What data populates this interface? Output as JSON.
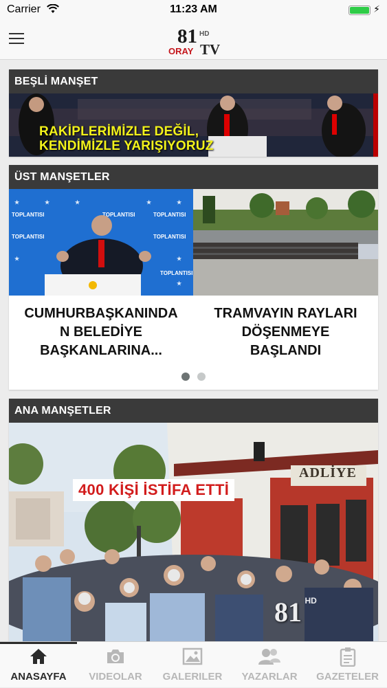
{
  "status_bar": {
    "carrier": "Carrier",
    "time": "11:23 AM"
  },
  "header": {
    "logo_text": "81",
    "logo_hd": "HD",
    "logo_brand": "ORAY",
    "logo_tv": "TV"
  },
  "sections": {
    "besli": {
      "title": "BEŞLİ MANŞET",
      "image_caption_line1": "RAKİPLERİMİZLE DEĞİL,",
      "image_caption_line2": "KENDİMİZLE YARIŞIYORUZ"
    },
    "ust": {
      "title": "ÜST MANŞETLER",
      "items": [
        {
          "headline_line1": "CUMHURBAŞKANINDA",
          "headline_line2": "N BELEDİYE",
          "headline_line3": "BAŞKANLARINA..."
        },
        {
          "headline_line1": "TRAMVAYIN RAYLARI",
          "headline_line2": "DÖŞENMEYE",
          "headline_line3": "BAŞLANDI"
        }
      ],
      "poster_word": "TOPLANTISI",
      "active_page": 1,
      "page_count": 2
    },
    "ana": {
      "title": "ANA MANŞETLER",
      "image_caption": "400 KİŞİ İSTİFA ETTİ",
      "building_sign": "ADLİYE",
      "watermark": "81",
      "watermark_hd": "HD"
    }
  },
  "tabbar": {
    "tabs": [
      {
        "label": "ANASAYFA",
        "icon": "home-icon",
        "active": true
      },
      {
        "label": "VIDEOLAR",
        "icon": "camera-icon",
        "active": false
      },
      {
        "label": "GALERILER",
        "icon": "gallery-icon",
        "active": false
      },
      {
        "label": "YAZARLAR",
        "icon": "writers-icon",
        "active": false
      },
      {
        "label": "GAZETELER",
        "icon": "newspaper-icon",
        "active": false
      }
    ]
  },
  "colors": {
    "section_header": "#3a3a3a",
    "accent_yellow": "#e7f01d",
    "logo_red": "#c4161c",
    "dot_active": "#6d7373",
    "dot_inactive": "#c6c9c9"
  }
}
